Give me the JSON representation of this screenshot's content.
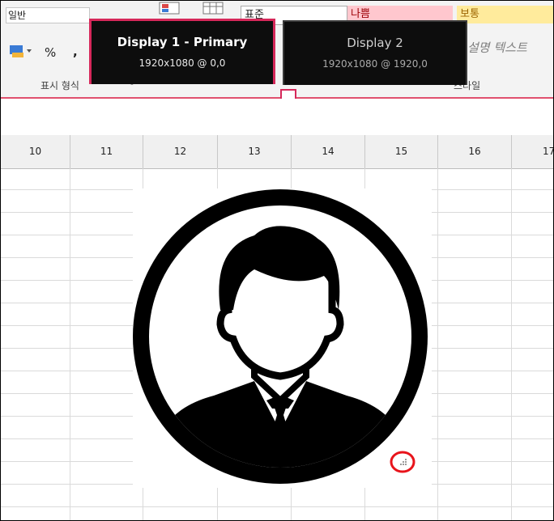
{
  "ribbon": {
    "number_format": "일반",
    "percent": "%",
    "comma": ",",
    "number_group_label": "표시 형식",
    "style_normal": "표준",
    "style_bad": "나쁨",
    "style_neutral": "보통",
    "style_explanatory": "설명 텍스트",
    "style_group_label": "스타일"
  },
  "displays": [
    {
      "name": "Display 1 - Primary",
      "resolution": "1920x1080 @ 0,0"
    },
    {
      "name": "Display 2",
      "resolution": "1920x1080 @ 1920,0"
    }
  ],
  "columns": [
    "10",
    "11",
    "12",
    "13",
    "14",
    "15",
    "16",
    "17"
  ],
  "picture": {
    "icon": "user-avatar-icon"
  },
  "colors": {
    "accent": "#d6285a",
    "bad_fill": "#ffc7ce",
    "neutral_fill": "#ffeb9c"
  }
}
